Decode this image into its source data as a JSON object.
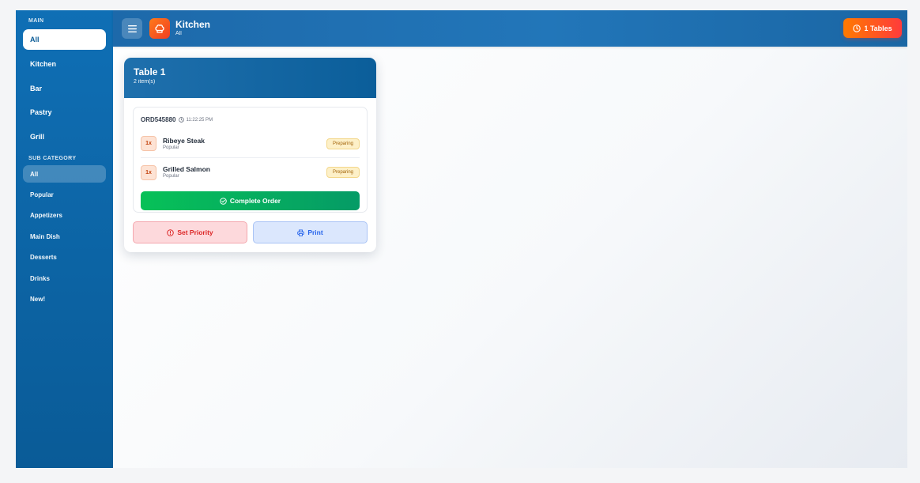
{
  "sidebar": {
    "main_title": "MAIN",
    "main_items": [
      {
        "label": "All",
        "active": true
      },
      {
        "label": "Kitchen"
      },
      {
        "label": "Bar"
      },
      {
        "label": "Pastry"
      },
      {
        "label": "Grill"
      }
    ],
    "sub_title": "SUB CATEGORY",
    "sub_items": [
      {
        "label": "All",
        "active": true
      },
      {
        "label": "Popular"
      },
      {
        "label": "Appetizers"
      },
      {
        "label": "Main Dish"
      },
      {
        "label": "Desserts"
      },
      {
        "label": "Drinks"
      },
      {
        "label": "New!"
      }
    ]
  },
  "header": {
    "title": "Kitchen",
    "subtitle": "All",
    "menu_icon": "hamburger-icon",
    "brand_icon": "chef-hat-icon",
    "tables_badge": "1 Tables",
    "tables_icon": "clock-icon"
  },
  "table_card": {
    "title": "Table 1",
    "subtitle": "2 item(s)",
    "order": {
      "id": "ORD545880",
      "time": "11:22:25 PM",
      "items": [
        {
          "qty": "1x",
          "name": "Ribeye Steak",
          "category": "Popular",
          "status": "Preparing"
        },
        {
          "qty": "1x",
          "name": "Grilled Salmon",
          "category": "Popular",
          "status": "Preparing"
        }
      ],
      "complete_label": "Complete Order"
    },
    "priority_label": "Set Priority",
    "print_label": "Print"
  },
  "colors": {
    "sidebar": "#0f6fb5",
    "header": "#2276b9",
    "badge": "#ff7a00",
    "complete": "#07c158",
    "priority": "#dc2626",
    "print": "#2563eb",
    "status_bg": "#fdf0c8"
  }
}
